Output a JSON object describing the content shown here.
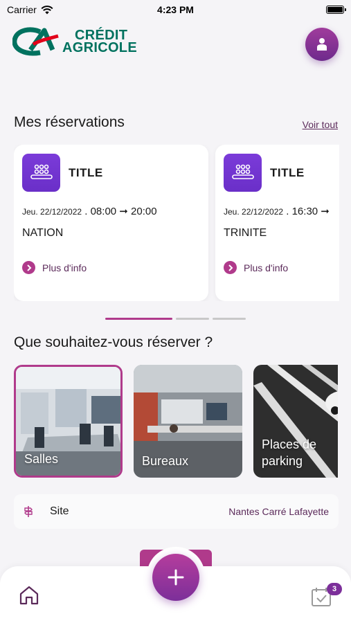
{
  "status_bar": {
    "carrier": "Carrier",
    "time": "4:23 PM"
  },
  "header": {
    "logo_line1": "CRÉDIT",
    "logo_line2": "AGRICOLE"
  },
  "reservations": {
    "title": "Mes réservations",
    "see_all": "Voir tout",
    "cards": [
      {
        "title": "TITLE",
        "day": "Jeu. 22/12/2022",
        "sep": ".",
        "time": "08:00 ➞ 20:00",
        "site": "NATION",
        "more": "Plus d'info"
      },
      {
        "title": "TITLE",
        "day": "Jeu. 22/12/2022",
        "sep": ".",
        "time": "16:30 ➞",
        "site": "TRINITE",
        "more": "Plus d'info"
      }
    ],
    "pager": {
      "count": 3,
      "active": 0
    }
  },
  "book": {
    "title": "Que souhaitez-vous réserver ?",
    "categories": [
      {
        "label": "Salles",
        "selected": true
      },
      {
        "label": "Bureaux",
        "selected": false
      },
      {
        "label": "Places de parking",
        "selected": false
      }
    ]
  },
  "site_row": {
    "label": "Site",
    "value": "Nantes Carré Lafayette"
  },
  "tabbar": {
    "badge": "3"
  },
  "colors": {
    "accent": "#b03a8b",
    "purple": "#6a2fc8",
    "logo_green": "#00725f",
    "logo_red": "#e2001a",
    "link": "#5b2a5a"
  }
}
